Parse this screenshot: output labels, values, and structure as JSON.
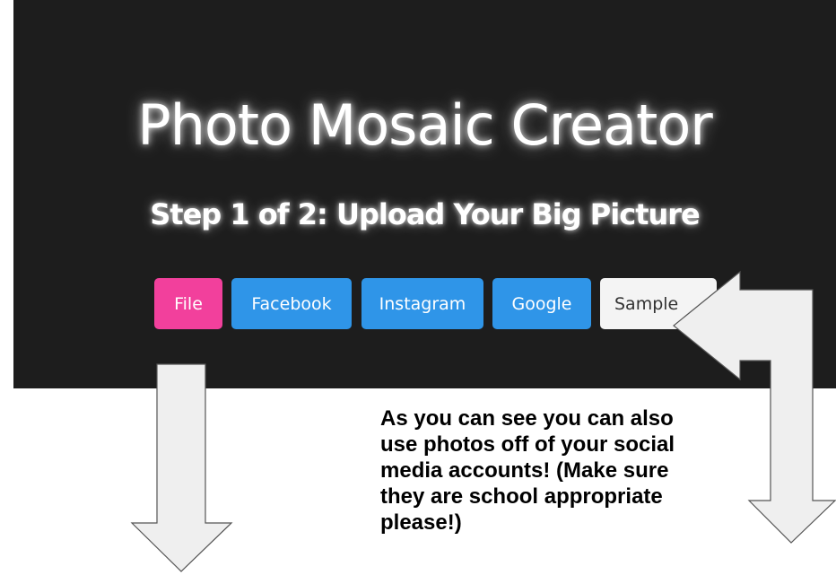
{
  "app": {
    "title": "Photo Mosaic Creator",
    "step_title": "Step 1 of 2: Upload Your Big Picture"
  },
  "upload_sources": {
    "file_label": "File",
    "facebook_label": "Facebook",
    "instagram_label": "Instagram",
    "google_label": "Google",
    "sample_label": "Sample"
  },
  "annotation": {
    "lines": [
      "As you can see you can also",
      "use photos off of your social",
      "media accounts! (Make sure",
      "they are school appropriate",
      "please!)"
    ]
  },
  "arrows": {
    "left_arrow": "down-arrow-icon",
    "right_arrow": "bent-arrow-icon"
  },
  "colors": {
    "panel_background": "#1d1d1d",
    "file_button": "#f2409c",
    "social_buttons": "#2f95e8",
    "sample_button": "#f4f4f4",
    "arrow_fill": "#efefef",
    "arrow_stroke": "#555555"
  }
}
